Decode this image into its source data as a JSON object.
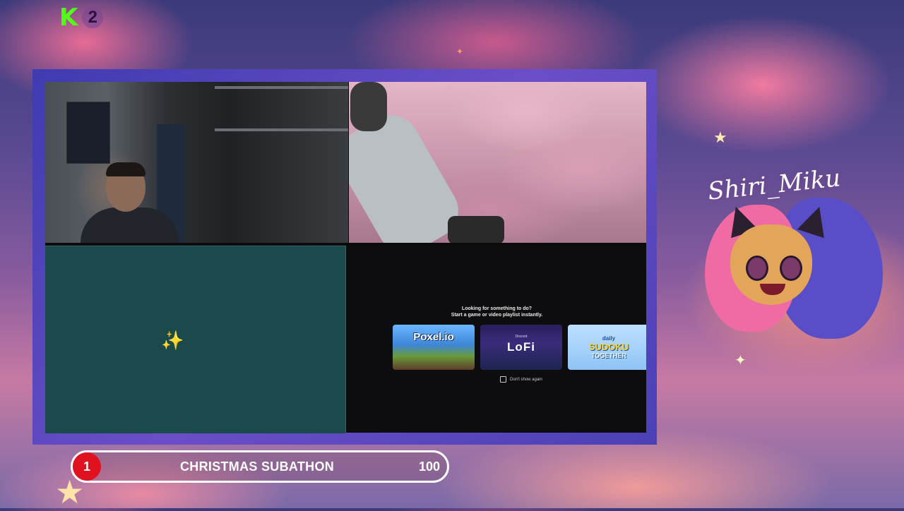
{
  "brand": {
    "kick_letter": "K",
    "kick_number": "2"
  },
  "streamer": {
    "signature": "Shiri_Miku"
  },
  "activity_prompt": {
    "line1": "Looking for something to do?",
    "line2": "Start a game or video playlist instantly.",
    "cards": [
      {
        "name": "Poxel.io"
      },
      {
        "name": "LoFi",
        "badge": "Discord"
      },
      {
        "name_small": "daily",
        "name_big": "SUDOKU",
        "name_tail": "TOGETHER"
      }
    ],
    "dont_show_again": "Don't show again"
  },
  "goal_bar": {
    "badge": "1",
    "label": "CHRISTMAS SUBATHON",
    "count": "100"
  },
  "colors": {
    "kick_green": "#53fc18",
    "frame": "#4b41b6",
    "goal_badge": "#e0121f"
  }
}
